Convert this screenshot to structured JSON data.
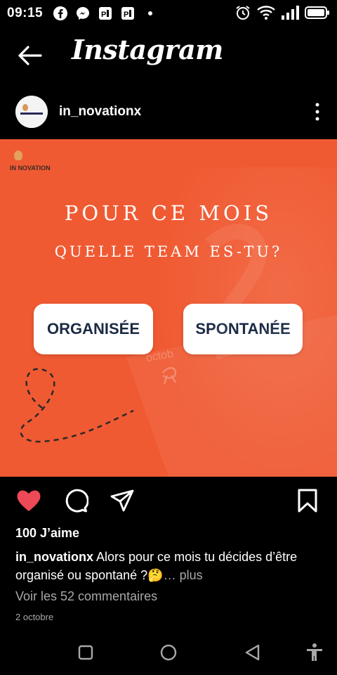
{
  "status_bar": {
    "time": "09:15",
    "left_icons": [
      "facebook-icon",
      "messenger-icon",
      "pdf-icon",
      "pdf-icon",
      "dot-icon"
    ],
    "right_icons": [
      "alarm-icon",
      "wifi-icon",
      "signal-icon",
      "battery-icon"
    ]
  },
  "header": {
    "title": "Instagram",
    "back_icon": "arrow-left-icon"
  },
  "post": {
    "username": "in_novationx",
    "image": {
      "logo_text": "IN NOVATION",
      "headline_1": "POUR CE MOIS",
      "headline_2": "QUELLE TEAM ES-TU?",
      "choice_1": "ORGANISÉE",
      "choice_2": "SPONTANÉE",
      "calendar_word": "octob",
      "background_color": "#f05a32"
    },
    "likes": "100 J’aime",
    "caption_user": "in_novationx",
    "caption_text": " Alors pour ce mois tu décides d’être organisé ou spontané ?🤔",
    "caption_more": "… plus",
    "comments_link": "Voir les 52 commentaires",
    "date": "2 octobre",
    "like_color": "#ed4956"
  },
  "navbar": {
    "icons": [
      "recents-square-icon",
      "home-circle-icon",
      "back-triangle-icon",
      "accessibility-icon"
    ]
  }
}
